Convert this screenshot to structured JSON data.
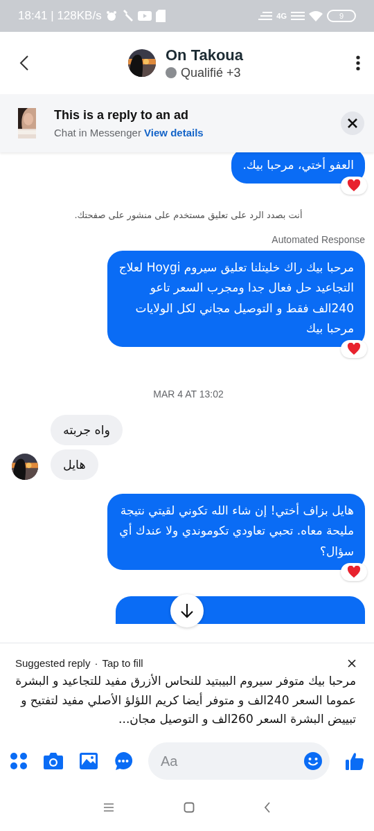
{
  "status_bar": {
    "time": "18:41 | 128KB/s",
    "network": "4G",
    "battery": "9"
  },
  "header": {
    "name": "On Takoua",
    "status": "Qualifié +3"
  },
  "ad_banner": {
    "title": "This is a reply to an ad",
    "subtitle": "Chat in Messenger",
    "link": "View details"
  },
  "messages": [
    {
      "kind": "outgoing",
      "text": "العفو أختي، مرحبا بيك.",
      "reacted": true
    },
    {
      "kind": "notice",
      "text": "أنت بصدد الرد على تعليق مستخدم على منشور على صفحتك."
    },
    {
      "kind": "label",
      "text": "Automated Response"
    },
    {
      "kind": "outgoing",
      "text": "مرحبا بيك راك خليتلنا تعليق سيروم Hoygi لعلاج التجاعيد حل فعال جدا ومجرب السعر تاعو 240الف فقط و التوصيل مجاني لكل الولايات مرحبا بيك",
      "reacted": true
    },
    {
      "kind": "date",
      "text": "MAR 4 AT 13:02"
    },
    {
      "kind": "incoming",
      "text": "واه جربته",
      "avatar": false
    },
    {
      "kind": "incoming",
      "text": "هايل",
      "avatar": true
    },
    {
      "kind": "outgoing",
      "text": "هايل بزاف أختي! إن شاء الله تكوني لقيتي نتيجة مليحة معاه. تحبي تعاودي تكوموندي ولا عندك أي سؤال؟",
      "reacted": true
    },
    {
      "kind": "cut"
    }
  ],
  "suggested_reply": {
    "label": "Suggested reply",
    "hint": "Tap to fill",
    "separator": "·",
    "text": "مرحبا بيك متوفر سيروم البيبتيد للنحاس الأزرق مفيد للتجاعيد و البشرة عموما السعر 240الف و متوفر أيضا كريم اللؤلؤ الأصلي مفيد لتفتيح و تبييض البشرة السعر 260الف و التوصيل مجان..."
  },
  "composer": {
    "placeholder": "Aa"
  }
}
